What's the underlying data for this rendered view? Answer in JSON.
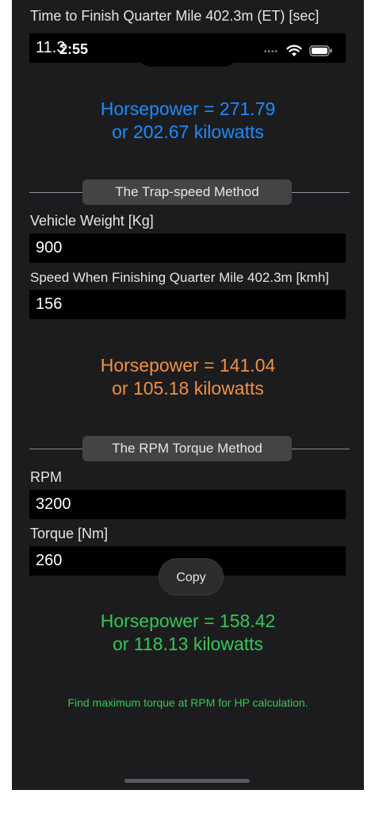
{
  "top_cut": {
    "label": "Time to Finish Quarter Mile 402.3m (ET) [sec]",
    "value": "11.3"
  },
  "status_bar": {
    "time": "2:55"
  },
  "et_method": {
    "result_hp": "Horsepower = 271.79",
    "result_kw": "or 202.67 kilowatts"
  },
  "trap_method": {
    "title": "The Trap-speed Method",
    "weight_label": "Vehicle Weight [Kg]",
    "weight_value": "900",
    "speed_label": "Speed When Finishing Quarter Mile 402.3m [kmh]",
    "speed_value": "156",
    "result_hp": "Horsepower = 141.04",
    "result_kw": "or 105.18 kilowatts"
  },
  "rpm_method": {
    "title": "The RPM Torque Method",
    "rpm_label": "RPM",
    "rpm_value": "3200",
    "torque_label": "Torque [Nm]",
    "torque_value": "260",
    "result_hp": "Horsepower = 158.42",
    "result_kw": "or 118.13 kilowatts",
    "note": "Find maximum torque at RPM for HP calculation."
  },
  "context_menu": {
    "copy_label": "Copy"
  },
  "colors": {
    "blue": "#1a8cff",
    "orange": "#f0913e",
    "green": "#34c759",
    "background": "#1c1c1e"
  },
  "icons": [
    "wifi-icon",
    "battery-icon",
    "signal-dots-icon"
  ]
}
